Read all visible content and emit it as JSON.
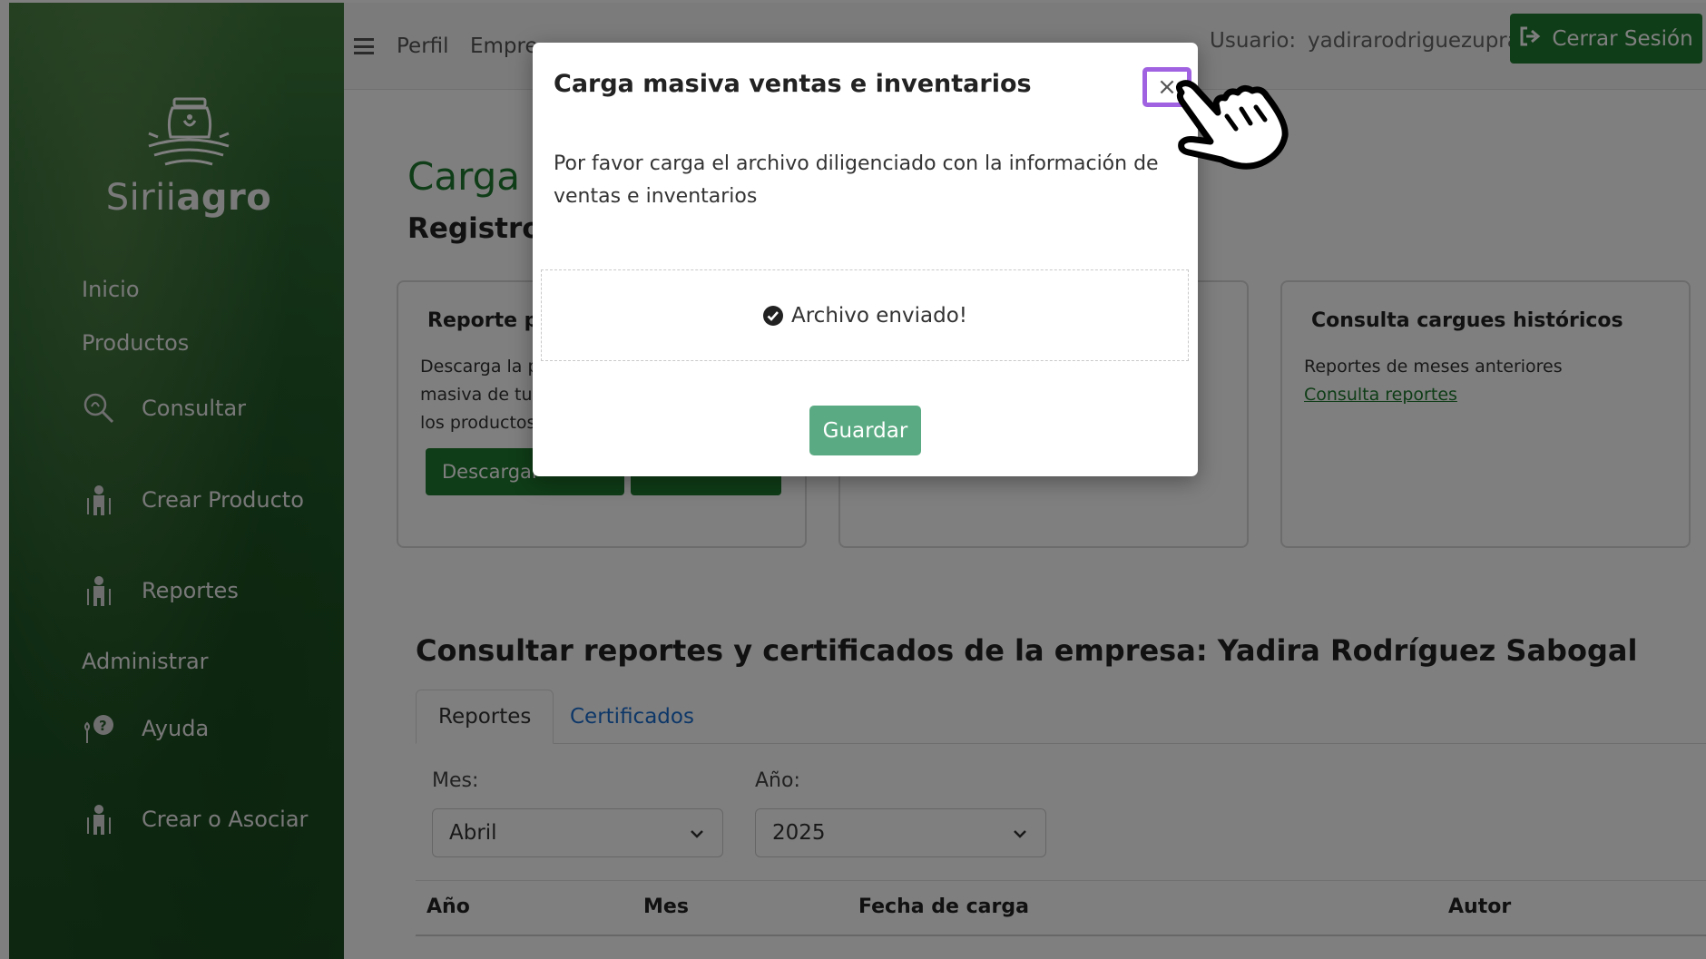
{
  "sidebar": {
    "brand_light": "Sirii",
    "brand_bold": "agro",
    "inicio": "Inicio",
    "productos": "Productos",
    "consultar": "Consultar",
    "crear_producto": "Crear Producto",
    "reportes": "Reportes",
    "administrar": "Administrar",
    "ayuda": "Ayuda",
    "crear_asociar": "Crear o Asociar",
    "icons": [
      "search-leaf-icon",
      "farmer-icon",
      "farmer-icon",
      "help-plant-icon",
      "farmer-icon"
    ]
  },
  "header": {
    "perfil": "Perfil",
    "empresa": "Empre",
    "user_label": "Usuario:",
    "user_name": "yadirarodriguezupra",
    "logout": "Cerrar Sesión"
  },
  "main": {
    "title": "Carga v",
    "subtitle": "Registro",
    "card1": {
      "title": "Reporte po",
      "line1": "Descarga la p",
      "line2": "masiva de tus",
      "line3": "los productos",
      "button": "Descargar"
    },
    "card3": {
      "title": "Consulta cargues históricos",
      "text": "Reportes de meses anteriores",
      "link": "Consulta reportes"
    },
    "section_title": "Consultar reportes y certificados de la empresa: Yadira Rodríguez Sabogal",
    "tabs": {
      "reportes": "Reportes",
      "certificados": "Certificados"
    },
    "filters": {
      "mes_label": "Mes:",
      "mes_value": "Abril",
      "anio_label": "Año:",
      "anio_value": "2025"
    },
    "table_headers": {
      "anio": "Año",
      "mes": "Mes",
      "fecha": "Fecha de carga",
      "autor": "Autor"
    }
  },
  "modal": {
    "title": "Carga masiva ventas e inventarios",
    "close": "×",
    "text": "Por favor carga el archivo diligenciado con la información de ventas e inventarios",
    "status": "Archivo enviado!",
    "save": "Guardar"
  },
  "colors": {
    "brand_green": "#1f7a2e",
    "save_button": "#5aab83",
    "highlight": "#a062e0",
    "link_blue": "#1a6fd1"
  }
}
